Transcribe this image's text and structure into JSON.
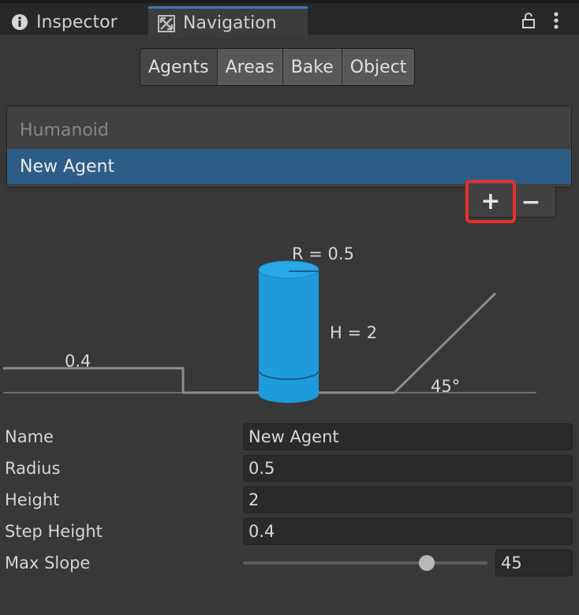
{
  "tabs": {
    "inspector": "Inspector",
    "navigation": "Navigation"
  },
  "segments": [
    "Agents",
    "Areas",
    "Bake",
    "Object"
  ],
  "active_segment": "Agents",
  "agent_list": {
    "items": [
      "Humanoid",
      "New Agent"
    ],
    "selected": "New Agent",
    "add_label": "+",
    "remove_label": "−"
  },
  "diagram": {
    "radius_label": "R = 0.5",
    "height_label": "H = 2",
    "step_label": "0.4",
    "slope_label": "45°"
  },
  "properties": {
    "name": {
      "label": "Name",
      "value": "New Agent"
    },
    "radius": {
      "label": "Radius",
      "value": "0.5"
    },
    "height": {
      "label": "Height",
      "value": "2"
    },
    "step_height": {
      "label": "Step Height",
      "value": "0.4"
    },
    "max_slope": {
      "label": "Max Slope",
      "value": "45",
      "fraction": 0.75
    }
  },
  "colors": {
    "accent_tab": "#3a79bb",
    "selection": "#2c5d87",
    "agent_cylinder": "#1e9bdc",
    "highlight": "#e8302a"
  },
  "icons": [
    "info-icon",
    "navigation-icon",
    "lock-icon",
    "more-icon"
  ]
}
